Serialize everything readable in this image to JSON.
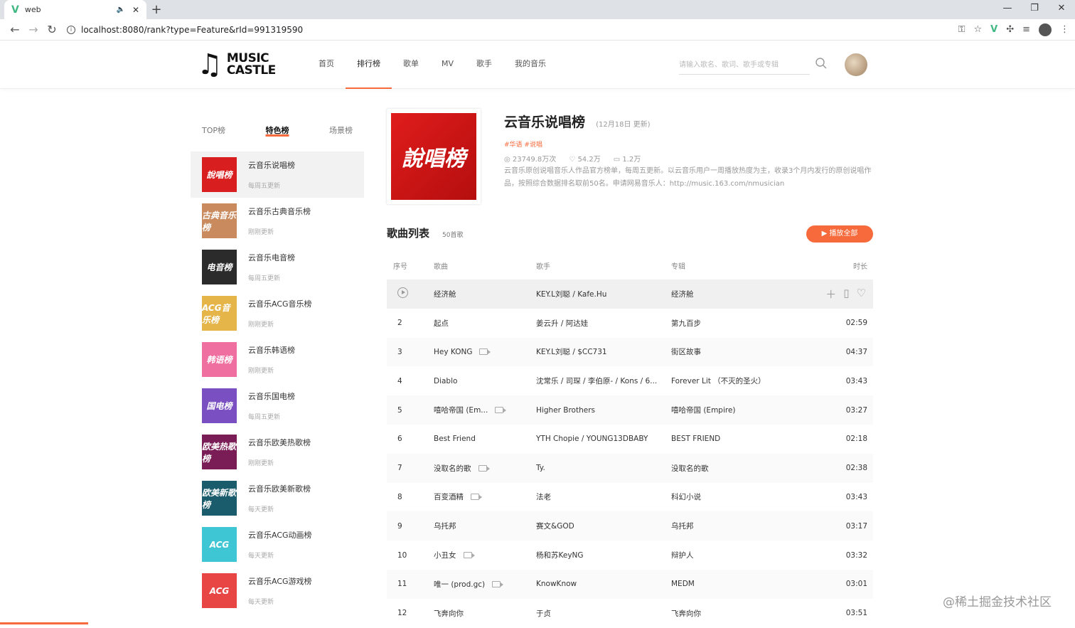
{
  "browser": {
    "tab_title": "web",
    "url": "localhost:8080/rank?type=Feature&rId=991319590"
  },
  "header": {
    "logo_line1": "MUSIC",
    "logo_line2": "CASTLE",
    "nav": [
      "首页",
      "排行榜",
      "歌单",
      "MV",
      "歌手",
      "我的音乐"
    ],
    "active_nav": 1,
    "search_placeholder": "请输入歌名、歌词、歌手或专辑"
  },
  "sidebar": {
    "tabs": [
      "TOP榜",
      "特色榜",
      "场景榜"
    ],
    "active_tab": 1,
    "items": [
      {
        "cover_text": "說唱榜",
        "name": "云音乐说唱榜",
        "update": "每周五更新",
        "color": "#d81e1e"
      },
      {
        "cover_text": "古典音乐榜",
        "name": "云音乐古典音乐榜",
        "update": "刚刚更新",
        "color": "#c98a5e"
      },
      {
        "cover_text": "电音榜",
        "name": "云音乐电音榜",
        "update": "每周五更新",
        "color": "#2b2b2b"
      },
      {
        "cover_text": "ACG音乐榜",
        "name": "云音乐ACG音乐榜",
        "update": "刚刚更新",
        "color": "#e5b54a"
      },
      {
        "cover_text": "韩语榜",
        "name": "云音乐韩语榜",
        "update": "刚刚更新",
        "color": "#ef6fa0"
      },
      {
        "cover_text": "国电榜",
        "name": "云音乐国电榜",
        "update": "每周五更新",
        "color": "#7a4fc2"
      },
      {
        "cover_text": "欧美热歌榜",
        "name": "云音乐欧美热歌榜",
        "update": "刚刚更新",
        "color": "#7a1c55"
      },
      {
        "cover_text": "欧美新歌榜",
        "name": "云音乐欧美新歌榜",
        "update": "每天更新",
        "color": "#1a5c6c"
      },
      {
        "cover_text": "ACG",
        "name": "云音乐ACG动画榜",
        "update": "每天更新",
        "color": "#3ec6d4"
      },
      {
        "cover_text": "ACG",
        "name": "云音乐ACG游戏榜",
        "update": "每天更新",
        "color": "#e84545"
      }
    ]
  },
  "hero": {
    "cover_text": "說唱榜",
    "title": "云音乐说唱榜",
    "date": "(12月18日 更新)",
    "tags": "#华语 #说唱",
    "plays": "23749.8万次",
    "likes": "54.2万",
    "comments": "1.2万",
    "desc": "云音乐原创说唱音乐人作品官方榜单，每周五更新。以云音乐用户一周播放热度为主，收录3个月内发行的原创说唱作品，按照综合数据排名取前50名。申请网易音乐人：http://music.163.com/nmusician"
  },
  "list": {
    "title": "歌曲列表",
    "count": "50首歌",
    "play_all": "播放全部",
    "columns": [
      "序号",
      "歌曲",
      "歌手",
      "专辑",
      "时长"
    ],
    "rows": [
      {
        "no": "",
        "song": "经济舱",
        "mv": false,
        "artist": "KEY.L刘聪 / Kafe.Hu",
        "album": "经济舱",
        "time": ""
      },
      {
        "no": "2",
        "song": "起点",
        "mv": false,
        "artist": "姜云升 / 阿达娃",
        "album": "第九百步",
        "time": "02:59"
      },
      {
        "no": "3",
        "song": "Hey KONG",
        "mv": true,
        "artist": "KEY.L刘聪 / $CC731",
        "album": "街区故事",
        "time": "04:37"
      },
      {
        "no": "4",
        "song": "Diablo",
        "mv": false,
        "artist": "沈常乐 / 司琛 / 李伯原- / Kons / 6...",
        "album": "Forever Lit （不灭的圣火）",
        "time": "03:43"
      },
      {
        "no": "5",
        "song": "嘻哈帝国 (Em...",
        "mv": true,
        "artist": "Higher Brothers",
        "album": "嘻哈帝国 (Empire)",
        "time": "03:27"
      },
      {
        "no": "6",
        "song": "Best Friend",
        "mv": false,
        "artist": "YTH Chopie / YOUNG13DBABY",
        "album": "BEST FRIEND",
        "time": "02:18"
      },
      {
        "no": "7",
        "song": "没取名的歌",
        "mv": true,
        "artist": "Ty.",
        "album": "没取名的歌",
        "time": "02:38"
      },
      {
        "no": "8",
        "song": "百变酒精",
        "mv": true,
        "artist": "法老",
        "album": "科幻小说",
        "time": "03:43"
      },
      {
        "no": "9",
        "song": "乌托邦",
        "mv": false,
        "artist": "赛文&GOD",
        "album": "乌托邦",
        "time": "03:17"
      },
      {
        "no": "10",
        "song": "小丑女",
        "mv": true,
        "artist": "杨和苏KeyNG",
        "album": "辩护人",
        "time": "03:32"
      },
      {
        "no": "11",
        "song": "唯一 (prod.gc)",
        "mv": true,
        "artist": "KnowKnow",
        "album": "MEDM",
        "time": "03:01"
      },
      {
        "no": "12",
        "song": "飞奔向你",
        "mv": false,
        "artist": "于贞",
        "album": "飞奔向你",
        "time": "03:51"
      }
    ]
  },
  "watermark": "@稀土掘金技术社区"
}
